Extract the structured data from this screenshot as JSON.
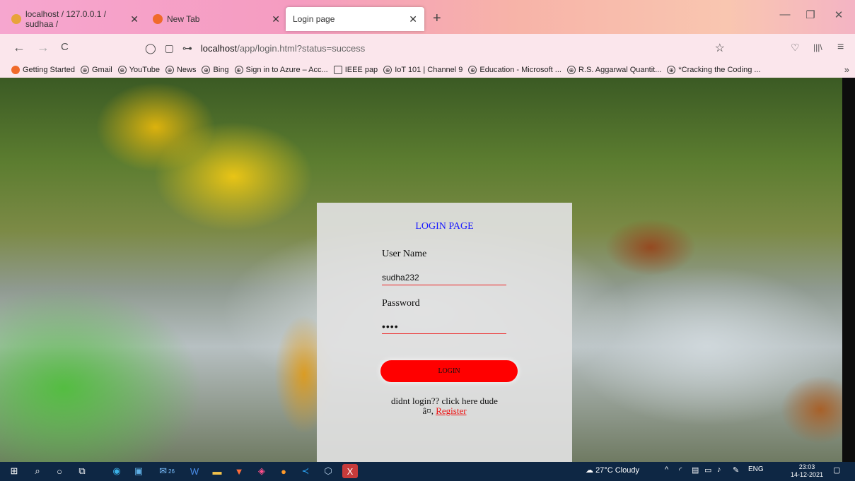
{
  "tabs": [
    {
      "title": "localhost / 127.0.0.1 / sudhaa /",
      "close": "✕",
      "favicon_color": "#e8a33a"
    },
    {
      "title": "New Tab",
      "close": "✕",
      "favicon_color": "#f06a2a"
    },
    {
      "title": "Login page",
      "close": "✕",
      "active": true
    }
  ],
  "new_tab": "+",
  "window_controls": {
    "minimize": "—",
    "restore": "❐",
    "close": "✕"
  },
  "nav": {
    "back": "←",
    "forward": "→",
    "reload": "C",
    "url_host": "localhost",
    "url_path": "/app/login.html?status=success",
    "bookmark_star": "☆",
    "pocket": "♡",
    "library": "|||\\",
    "menu": "≡"
  },
  "bookmarks": [
    "Getting Started",
    "Gmail",
    "YouTube",
    "News",
    "Bing",
    "Sign in to Azure – Acc...",
    "IEEE pap",
    "IoT 101 | Channel 9",
    "Education - Microsoft ...",
    "R.S. Aggarwal Quantit...",
    "*Cracking the Coding ..."
  ],
  "bookmarks_more": "»",
  "login": {
    "title": "LOGIN PAGE",
    "username_label": "User Name",
    "username_value": "sudha232",
    "password_label": "Password",
    "password_value": "••••",
    "button_label": "LOGIN",
    "note_text": "didnt login?? click here dude",
    "note_prefix": "â¤, ",
    "register_link": "Register"
  },
  "taskbar": {
    "weather": "27°C  Cloudy",
    "language": "ENG",
    "time": "23:03",
    "date": "14-12-2021",
    "badge": "26"
  },
  "colors": {
    "accent_title": "#1a1aff",
    "login_button": "#ff0000",
    "register_link": "#ee1111",
    "taskbar": "#0e2744"
  }
}
